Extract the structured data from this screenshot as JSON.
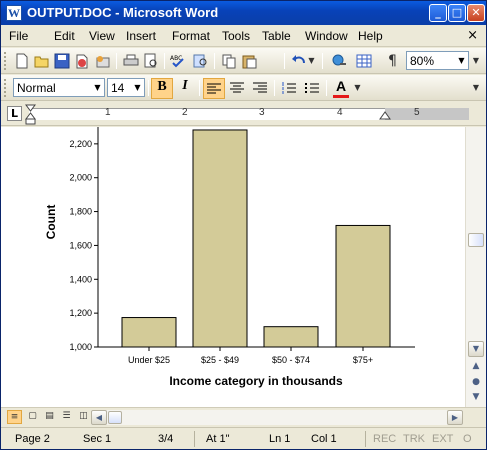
{
  "window": {
    "title": "OUTPUT.DOC - Microsoft Word",
    "controls": {
      "minimize": "_",
      "maximize": "□",
      "close": "✕"
    }
  },
  "menu": {
    "items": [
      "File",
      "Edit",
      "View",
      "Insert",
      "Format",
      "Tools",
      "Table",
      "Window",
      "Help"
    ],
    "close_glyph": "×"
  },
  "standard_toolbar": {
    "icons": [
      "new-icon",
      "open-icon",
      "save-icon",
      "permission-icon",
      "email-icon",
      "print-icon",
      "print-preview-icon",
      "spelling-icon",
      "research-icon",
      "copy-icon",
      "paste-icon",
      "undo-icon",
      "hyperlink-icon",
      "table-icon",
      "show-formatting-icon"
    ],
    "zoom": "80%"
  },
  "formatting_toolbar": {
    "style": "Normal",
    "size": "14",
    "bold": "B",
    "italic": "I",
    "font_color_label": "A"
  },
  "ruler": {
    "numbers": [
      "1",
      "2",
      "3",
      "4",
      "5"
    ],
    "tab_selector": "L"
  },
  "chart_data": {
    "type": "bar",
    "categories": [
      "Under $25",
      "$25 - $49",
      "$50 - $74",
      "$75+"
    ],
    "values": [
      1174,
      2282,
      1120,
      1718
    ],
    "xlabel": "Income category in thousands",
    "ylabel": "Count",
    "ylim": [
      1000,
      2270
    ],
    "yticks": [
      "1,000",
      "1,200",
      "1,400",
      "1,600",
      "1,800",
      "2,000",
      "2,200"
    ],
    "ytick_values": [
      1000,
      1200,
      1400,
      1600,
      1800,
      2000,
      2200
    ],
    "bar_color": "#d3cb98",
    "bar_stroke": "#000000",
    "grid": false
  },
  "statusbar": {
    "page": "Page 2",
    "sec": "Sec 1",
    "pages": "3/4",
    "at": "At 1\"",
    "ln": "Ln 1",
    "col": "Col 1",
    "rec": "REC",
    "trk": "TRK",
    "ext": "EXT",
    "ovr": "O"
  }
}
